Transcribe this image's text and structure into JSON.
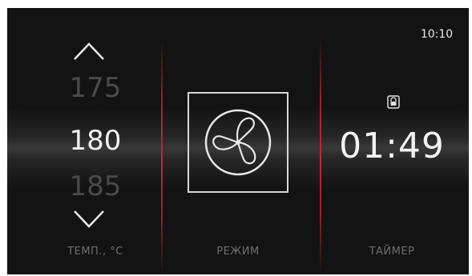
{
  "status": {
    "time": "10:10"
  },
  "temperature": {
    "prev": "175",
    "current": "180",
    "next": "185",
    "label": "ТЕМП., °С"
  },
  "mode": {
    "icon": "fan-icon",
    "label": "РЕЖИМ"
  },
  "timer": {
    "value": "01:49",
    "label": "ТАЙМЕР",
    "icon": "lock-icon"
  },
  "colors": {
    "background": "#131313",
    "divider": "#c82828",
    "text": "#f2f2f2"
  }
}
